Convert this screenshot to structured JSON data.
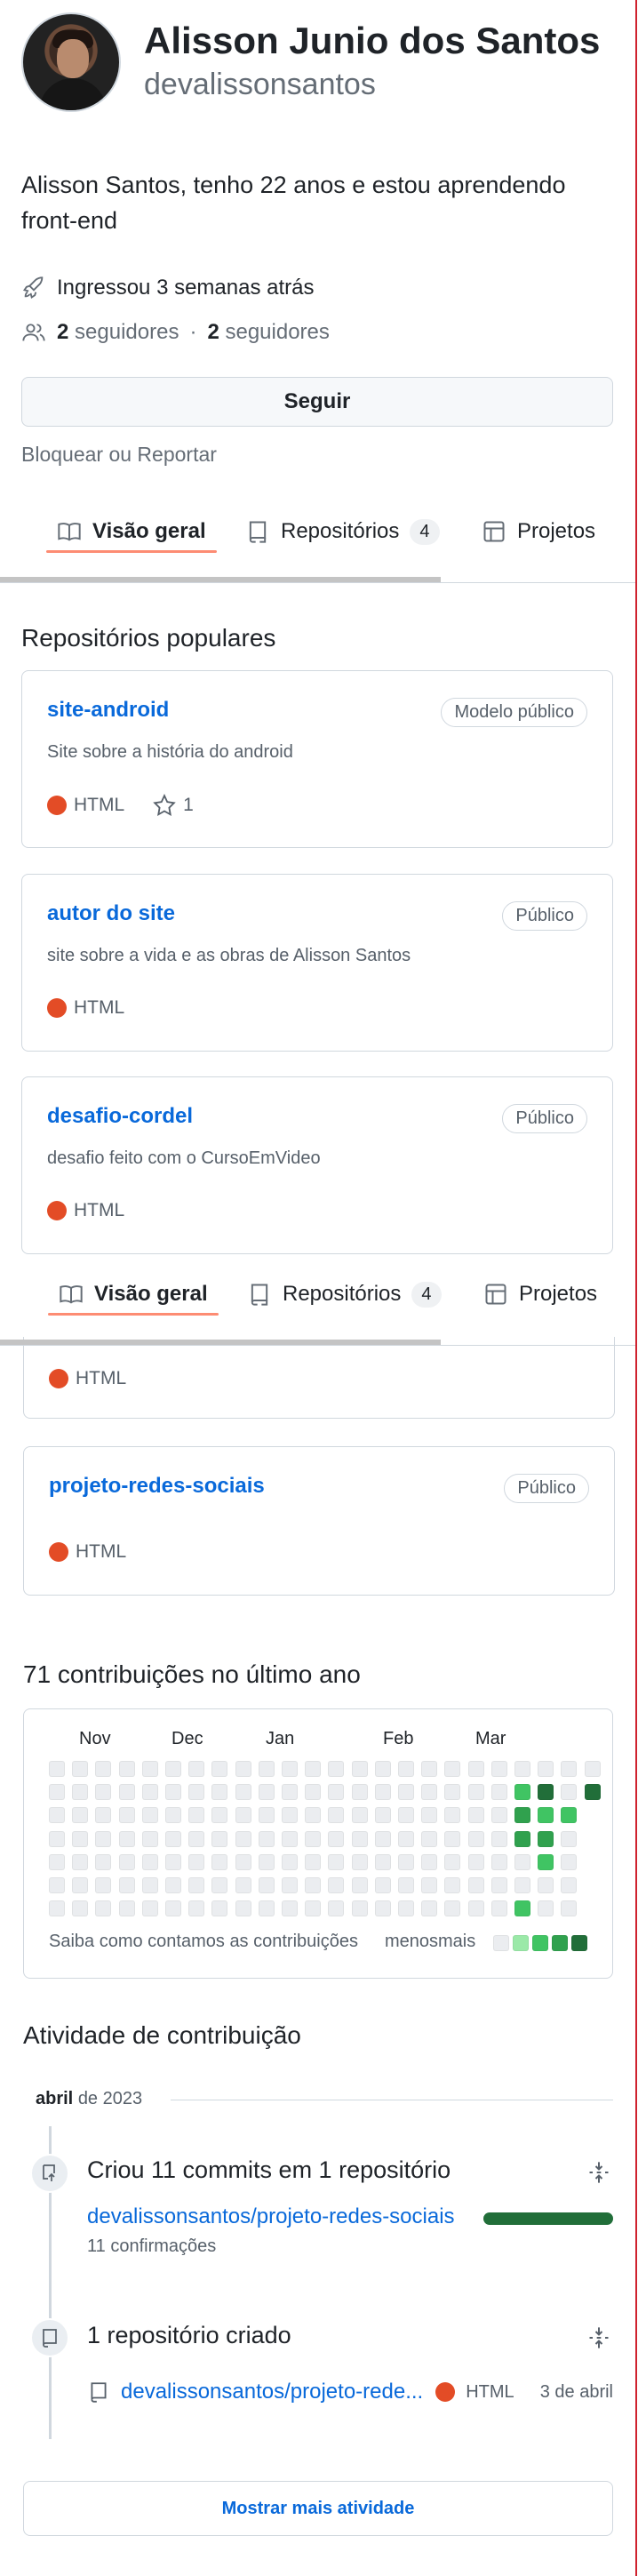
{
  "profile": {
    "name": "Alisson Junio dos Santos",
    "login": "devalissonsantos",
    "bio": "Alisson Santos, tenho 22 anos e estou aprendendo front-end",
    "joined": "Ingressou 3 semanas atrás",
    "followers_count": "2",
    "followers_label": "seguidores",
    "separator": "·",
    "following_count": "2",
    "following_label": "seguidores",
    "follow_button": "Seguir",
    "block_link": "Bloquear ou Reportar"
  },
  "tabs": [
    {
      "label": "Visão geral",
      "icon": "book-icon",
      "active": true
    },
    {
      "label": "Repositórios",
      "icon": "repo-icon",
      "count": "4"
    },
    {
      "label": "Projetos",
      "icon": "table-icon"
    }
  ],
  "popular": {
    "title": "Repositórios populares",
    "repos": [
      {
        "name": "site-android",
        "badge": "Modelo público",
        "description": "Site sobre a história do android",
        "language": "HTML",
        "stars": "1"
      },
      {
        "name": "autor do site",
        "badge": "Público",
        "description": "site sobre a vida e as obras de Alisson Santos",
        "language": "HTML"
      },
      {
        "name": "desafio-cordel",
        "badge": "Público",
        "description": "desafio feito com o CursoEmVideo",
        "language": "HTML"
      },
      {
        "language": "HTML"
      },
      {
        "name": "projeto-redes-sociais",
        "badge": "Público",
        "language": "HTML"
      }
    ]
  },
  "contributions": {
    "title": "71 contribuições no último ano",
    "months": [
      "Nov",
      "Dec",
      "Jan",
      "Feb",
      "Mar"
    ],
    "learn": "Saiba como contamos as contribuições",
    "less": "menos",
    "more": "mais",
    "colors": [
      "#ebedf0",
      "#9be9a8",
      "#40c463",
      "#30a14e",
      "#216e39"
    ]
  },
  "activity": {
    "title": "Atividade de contribuição",
    "month": "abril",
    "year": "de 2023",
    "commits": {
      "title": "Criou 11 commits em 1 repositório",
      "repo": "devalissonsantos/projeto-redes-sociais",
      "detail": "11 confirmações"
    },
    "created": {
      "title": "1 repositório criado",
      "repo": "devalissonsantos/projeto-rede...",
      "language": "HTML",
      "date": "3 de abril"
    },
    "show_more": "Mostrar mais atividade"
  }
}
